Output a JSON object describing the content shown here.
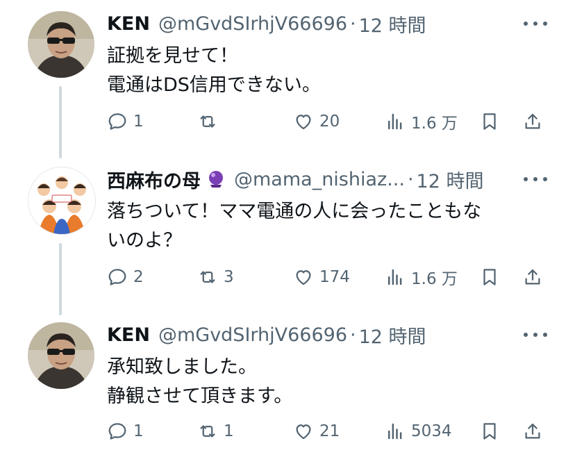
{
  "posts": [
    {
      "name": "KEN",
      "handle": "@mGvdSIrhjV66696",
      "dot": "·",
      "time": "12 時間",
      "lines": [
        "証拠を見せて！",
        "電通はDS信用できない。"
      ],
      "replies": "1",
      "reposts": "",
      "likes": "20",
      "views": "1.6 万"
    },
    {
      "name": "西麻布の母",
      "handle": "@mama_nishiaz...",
      "dot": "·",
      "time": "12 時間",
      "lines": [
        "落ちついて！ママ電通の人に会ったこともな",
        "いのよ？"
      ],
      "replies": "2",
      "reposts": "3",
      "likes": "174",
      "views": "1.6 万"
    },
    {
      "name": "KEN",
      "handle": "@mGvdSIrhjV66696",
      "dot": "·",
      "time": "12 時間",
      "lines": [
        "承知致しました。",
        "静観させて頂きます。"
      ],
      "replies": "1",
      "reposts": "1",
      "likes": "21",
      "views": "5034"
    }
  ],
  "colors": {
    "text": "#0f1419",
    "secondary": "#536471",
    "thread_line": "#cfd9de",
    "badge": "#7b3fb5"
  },
  "icons": {
    "reply": "speech-bubble-icon",
    "repost": "repost-arrows-icon",
    "like": "heart-icon",
    "views": "bar-chart-icon",
    "bookmark": "bookmark-icon",
    "share": "share-upload-icon",
    "more": "more-dots-icon",
    "badge": "crystal-ball-icon"
  }
}
